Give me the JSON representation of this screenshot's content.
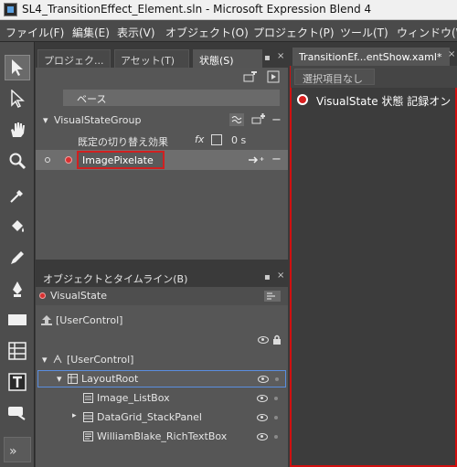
{
  "window": {
    "title": "SL4_TransitionEffect_Element.sln - Microsoft Expression Blend 4"
  },
  "menu": [
    "ファイル(F)",
    "編集(E)",
    "表示(V)",
    "オブジェクト(O)",
    "プロジェクト(P)",
    "ツール(T)",
    "ウィンドウ(W)"
  ],
  "left_tabs": {
    "projects": "プロジェク...",
    "assets": "アセット(T)",
    "states": "状態(S)"
  },
  "states": {
    "base_label": "ベース",
    "group_name": "VisualStateGroup",
    "default_transition_label": "既定の切り替え効果",
    "default_transition_value": "0 s",
    "fx_label": "fx",
    "editing_state_name": "ImagePixelate"
  },
  "objects": {
    "panel_title": "オブジェクトとタイムライン(B)",
    "current_state": "VisualState",
    "scope_root": "[UserControl]",
    "tree": {
      "root": "[UserControl]",
      "layout_root": "LayoutRoot",
      "children": [
        "Image_ListBox",
        "DataGrid_StackPanel",
        "WilliamBlake_RichTextBox"
      ]
    }
  },
  "document": {
    "tab_title": "TransitionEf...entShow.xaml*",
    "toolbar_label": "選択項目なし",
    "recording_banner": "VisualState 状態 記録オン"
  },
  "colors": {
    "accent_red": "#d01010",
    "panel_bg": "#565656",
    "window_bg": "#3a3a3a"
  },
  "icons": [
    "selection-arrow-icon",
    "direct-select-icon",
    "pan-hand-icon",
    "zoom-icon",
    "eyedropper-icon",
    "paint-bucket-icon",
    "pencil-icon",
    "pen-icon",
    "rectangle-icon",
    "grid-icon",
    "text-icon",
    "assets-icon",
    "expand-chevron-icon"
  ]
}
